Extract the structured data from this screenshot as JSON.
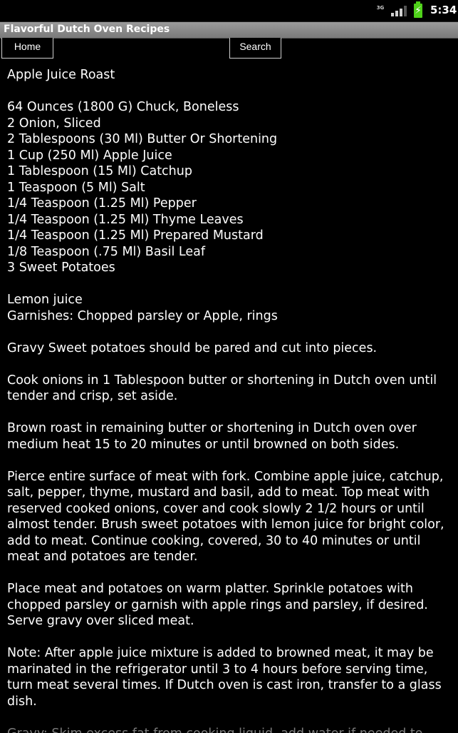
{
  "status_bar": {
    "network": "3G",
    "signal_icon": "signal-bars-icon",
    "battery_icon": "battery-charging-icon",
    "time": "5:34"
  },
  "app": {
    "title": "Flavorful Dutch Oven Recipes"
  },
  "nav": {
    "home_label": "Home",
    "search_label": "Search"
  },
  "recipe": {
    "title": "Apple Juice Roast",
    "ingredients": [
      "64 Ounces (1800 G) Chuck, Boneless",
      "2 Onion, Sliced",
      "2 Tablespoons (30 Ml) Butter Or Shortening",
      "1 Cup (250 Ml) Apple Juice",
      "1 Tablespoon (15 Ml) Catchup",
      "1 Teaspoon (5 Ml) Salt",
      "1/4 Teaspoon (1.25 Ml) Pepper",
      "1/4 Teaspoon (1.25 Ml) Thyme Leaves",
      "1/4 Teaspoon (1.25 Ml) Prepared Mustard",
      "1/8 Teaspoon (.75 Ml) Basil Leaf",
      "3 Sweet Potatoes"
    ],
    "extras": [
      "Lemon juice",
      "Garnishes: Chopped parsley or Apple, rings"
    ],
    "steps": [
      "Gravy Sweet potatoes should be pared and cut into pieces.",
      "Cook onions in 1 Tablespoon butter or shortening in Dutch oven until tender and crisp, set aside.",
      "Brown roast in remaining butter or shortening in Dutch oven over medium heat 15 to 20 minutes or until browned on both sides.",
      "Pierce entire surface of meat with fork. Combine apple juice, catchup, salt, pepper, thyme, mustard and basil, add to meat. Top meat with reserved cooked onions, cover and cook slowly 2 1/2 hours or until almost tender. Brush sweet potatoes with lemon juice for bright color, add to meat. Continue cooking, covered, 30 to 40 minutes or until meat and potatoes are tender.",
      "Place meat and potatoes on warm platter. Sprinkle potatoes with chopped parsley or garnish with apple rings and parsley, if desired. Serve gravy over sliced meat.",
      "Note: After apple juice mixture is added to browned meat, it may be marinated in the refrigerator until 3 to 4 hours before serving time, turn meat several times. If Dutch oven is cast iron, transfer to a glass dish.",
      "Gravy: Skim excess fat from cooking liquid, add water if needed to"
    ]
  }
}
